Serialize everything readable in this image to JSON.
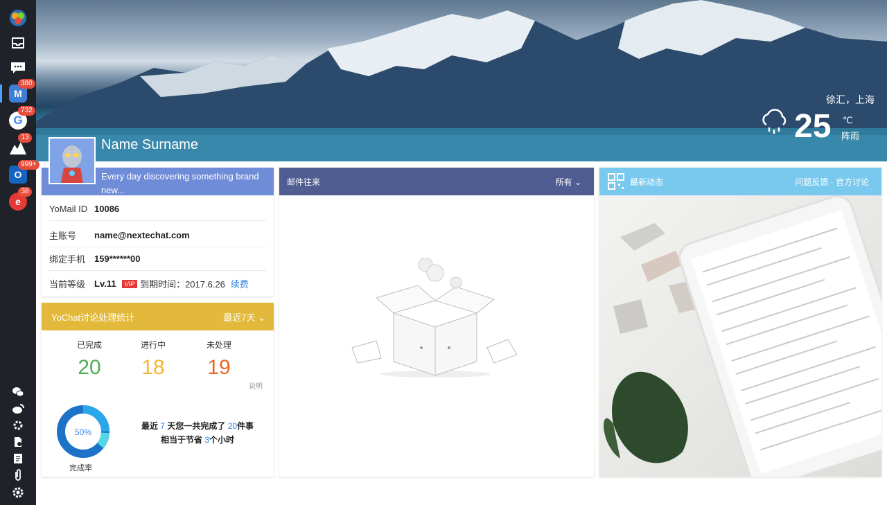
{
  "sidebar": {
    "badges": {
      "yomail": "380",
      "google": "732",
      "app3": "13",
      "outlook": "999+",
      "app5": "38"
    },
    "icons": [
      "yochat-logo-icon",
      "inbox-icon",
      "chat-icon",
      "yomail-icon",
      "google-icon",
      "mountain-app-icon",
      "outlook-icon",
      "red-app-icon",
      "wechat-icon",
      "weibo-icon",
      "plugin-icon",
      "contacts-icon",
      "notes-icon",
      "attachment-icon",
      "settings-icon"
    ]
  },
  "banner": {
    "location": "徐汇，上海",
    "temperature": "25",
    "unit": "℃",
    "condition": "阵雨"
  },
  "profile": {
    "name": "Name Surname",
    "motto": "Every day discovering something brand new...",
    "rows": {
      "id_label": "YoMail ID",
      "id_value": "10086",
      "main_label": "主账号",
      "main_value": "name@nextechat.com",
      "phone_label": "绑定手机",
      "phone_value": "159******00",
      "level_label": "当前等级",
      "level_value": "Lv.11",
      "vip": "VIP",
      "expire": "到期时间：2017.6.26",
      "renew": "续费"
    }
  },
  "stats": {
    "title": "YoChat讨论处理统计",
    "range": "最近7天",
    "done_label": "已完成",
    "done_value": "20",
    "progress_label": "进行中",
    "progress_value": "18",
    "pending_label": "未处理",
    "pending_value": "19",
    "explain": "说明",
    "completion_pct": "50%",
    "completion_label": "完成率",
    "summary_1a": "最近",
    "summary_days": "7",
    "summary_1b": "天您一共完成了",
    "summary_count": "20",
    "summary_1c": "件事",
    "summary_2a": "相当于节省",
    "summary_hours": "3",
    "summary_2b": "个小时"
  },
  "mail": {
    "title": "邮件往来",
    "filter": "所有"
  },
  "news": {
    "title": "最新动态",
    "links": "问题反馈 · 官方讨论"
  },
  "colors": {
    "done": "#4caf50",
    "progress": "#f2b632",
    "pending": "#e8671e",
    "accent": "#2f80ed"
  }
}
